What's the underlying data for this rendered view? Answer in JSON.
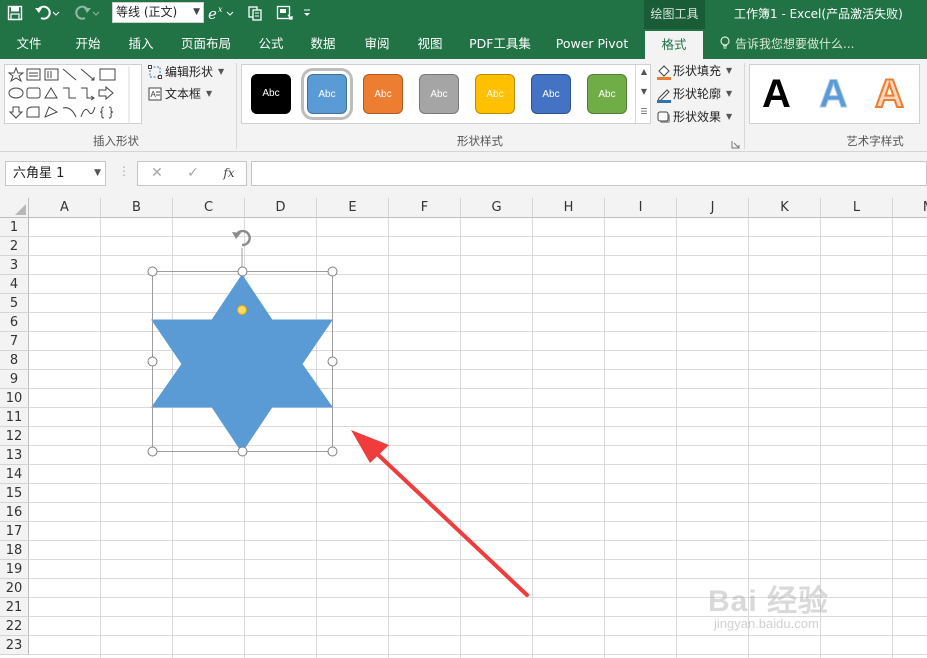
{
  "quick_access": {
    "font_name": "等线 (正文)",
    "exponent_icon": "e-superscript-x-icon"
  },
  "window": {
    "context_tab": "绘图工具",
    "title": "工作簿1 - Excel(产品激活失败)"
  },
  "tabs": [
    {
      "label": "文件"
    },
    {
      "label": "开始"
    },
    {
      "label": "插入"
    },
    {
      "label": "页面布局"
    },
    {
      "label": "公式"
    },
    {
      "label": "数据"
    },
    {
      "label": "审阅"
    },
    {
      "label": "视图"
    },
    {
      "label": "PDF工具集"
    },
    {
      "label": "Power Pivot"
    },
    {
      "label": "格式"
    }
  ],
  "active_tab": "格式",
  "tell_me": "告诉我您想要做什么...",
  "ribbon": {
    "insert_shapes": {
      "edit_shape": "编辑形状",
      "text_box": "文本框",
      "label": "插入形状"
    },
    "shape_styles": {
      "tiles": [
        {
          "text": "Abc",
          "color": "#000000"
        },
        {
          "text": "Abc",
          "color": "#5b9bd5"
        },
        {
          "text": "Abc",
          "color": "#ed7d31"
        },
        {
          "text": "Abc",
          "color": "#a5a5a5"
        },
        {
          "text": "Abc",
          "color": "#ffc000"
        },
        {
          "text": "Abc",
          "color": "#4472c4"
        },
        {
          "text": "Abc",
          "color": "#70ad47"
        }
      ],
      "selected_index": 1,
      "fill": "形状填充",
      "outline": "形状轮廓",
      "effects": "形状效果",
      "label": "形状样式"
    },
    "wordart": {
      "letters": [
        {
          "text": "A",
          "color": "#000000"
        },
        {
          "text": "A",
          "color": "#5b9bd5"
        },
        {
          "text": "A",
          "color": "#ed7d31"
        }
      ],
      "label": "艺术字样式"
    }
  },
  "formula_bar": {
    "name_box": "六角星 1",
    "cancel_icon": "cancel-x-icon",
    "enter_icon": "checkmark-icon",
    "function_label": "fx",
    "formula": ""
  },
  "sheet": {
    "columns": [
      "A",
      "B",
      "C",
      "D",
      "E",
      "F",
      "G",
      "H",
      "I",
      "J",
      "K",
      "L",
      "M"
    ],
    "rows": [
      "1",
      "2",
      "3",
      "4",
      "5",
      "6",
      "7",
      "8",
      "9",
      "10",
      "11",
      "12",
      "13",
      "14",
      "15",
      "16",
      "17",
      "18",
      "19",
      "20",
      "21",
      "22",
      "23"
    ],
    "shape": {
      "name": "六角星 1",
      "type": "six-point-star",
      "fill": "#5b9bd5",
      "selected": true
    },
    "annotation_arrow_color": "#f03c3c"
  },
  "watermark": {
    "logo": "Bai 经验",
    "url": "jingyan.baidu.com"
  }
}
